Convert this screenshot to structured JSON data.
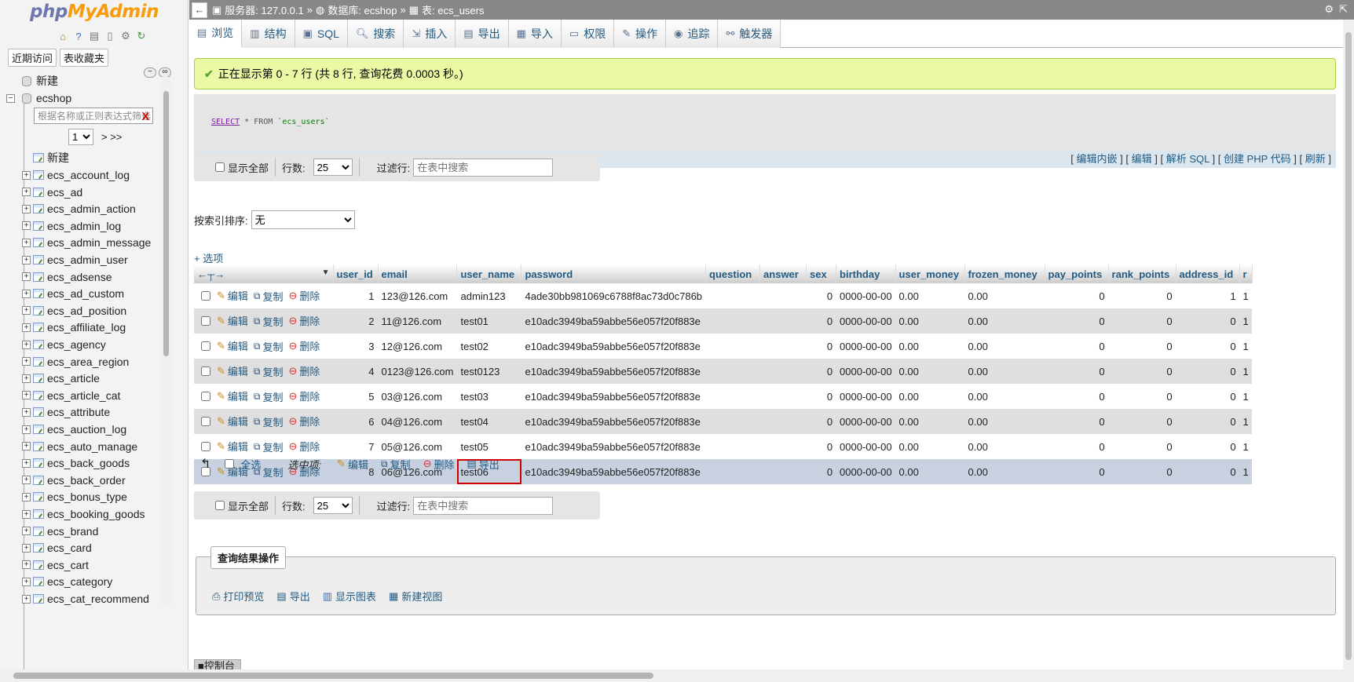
{
  "app": {
    "logo_part1": "php",
    "logo_part2": "MyAdmin",
    "recent_label": "近期访问",
    "favorites_label": "表收藏夹"
  },
  "nav": {
    "new_label": "新建",
    "db_name": "ecshop",
    "filter_placeholder": "根据名称或正则表达式筛选",
    "filter_clear": "X",
    "page_select": "1",
    "page_next": "> >>",
    "db_new_label": "新建",
    "tables": [
      "ecs_account_log",
      "ecs_ad",
      "ecs_admin_action",
      "ecs_admin_log",
      "ecs_admin_message",
      "ecs_admin_user",
      "ecs_adsense",
      "ecs_ad_custom",
      "ecs_ad_position",
      "ecs_affiliate_log",
      "ecs_agency",
      "ecs_area_region",
      "ecs_article",
      "ecs_article_cat",
      "ecs_attribute",
      "ecs_auction_log",
      "ecs_auto_manage",
      "ecs_back_goods",
      "ecs_back_order",
      "ecs_bonus_type",
      "ecs_booking_goods",
      "ecs_brand",
      "ecs_card",
      "ecs_cart",
      "ecs_category",
      "ecs_cat_recommend"
    ]
  },
  "breadcrumb": {
    "server": "服务器: 127.0.0.1",
    "database": "数据库: ecshop",
    "table": "表: ecs_users",
    "sep": "»"
  },
  "tabs": [
    {
      "label": "浏览",
      "icon": "browse-icon"
    },
    {
      "label": "结构",
      "icon": "structure-icon"
    },
    {
      "label": "SQL",
      "icon": "sql-icon"
    },
    {
      "label": "搜索",
      "icon": "search-icon"
    },
    {
      "label": "插入",
      "icon": "insert-icon"
    },
    {
      "label": "导出",
      "icon": "export-icon"
    },
    {
      "label": "导入",
      "icon": "import-icon"
    },
    {
      "label": "权限",
      "icon": "privileges-icon"
    },
    {
      "label": "操作",
      "icon": "operations-icon"
    },
    {
      "label": "追踪",
      "icon": "tracking-icon"
    },
    {
      "label": "触发器",
      "icon": "triggers-icon"
    }
  ],
  "result": {
    "message": "正在显示第 0 - 7 行 (共 8 行, 查询花费 0.0003 秒。)",
    "sql_select": "SELECT",
    "sql_rest": "* FROM",
    "sql_table": "`ecs_users`",
    "sql_links": [
      "编辑内嵌",
      "编辑",
      "解析 SQL",
      "创建 PHP 代码",
      "刷新"
    ]
  },
  "navbar": {
    "show_all": "显示全部",
    "rows_label": "行数:",
    "rows_value": "25",
    "filter_label": "过滤行:",
    "filter_placeholder": "在表中搜索"
  },
  "sort": {
    "label": "按索引排序:",
    "value": "无"
  },
  "options_link": "+ 选项",
  "actions": {
    "edit": "编辑",
    "copy": "复制",
    "delete": "删除"
  },
  "columns": [
    "user_id",
    "email",
    "user_name",
    "password",
    "question",
    "answer",
    "sex",
    "birthday",
    "user_money",
    "frozen_money",
    "pay_points",
    "rank_points",
    "address_id",
    "r"
  ],
  "rows": [
    {
      "user_id": "1",
      "email": "123@126.com",
      "user_name": "admin123",
      "password": "4ade30bb981069c6788f8ac73d0c786b",
      "question": "",
      "answer": "",
      "sex": "0",
      "birthday": "0000-00-00",
      "user_money": "0.00",
      "frozen_money": "0.00",
      "pay_points": "0",
      "rank_points": "0",
      "address_id": "1",
      "r": "1"
    },
    {
      "user_id": "2",
      "email": "11@126.com",
      "user_name": "test01",
      "password": "e10adc3949ba59abbe56e057f20f883e",
      "question": "",
      "answer": "",
      "sex": "0",
      "birthday": "0000-00-00",
      "user_money": "0.00",
      "frozen_money": "0.00",
      "pay_points": "0",
      "rank_points": "0",
      "address_id": "0",
      "r": "1"
    },
    {
      "user_id": "3",
      "email": "12@126.com",
      "user_name": "test02",
      "password": "e10adc3949ba59abbe56e057f20f883e",
      "question": "",
      "answer": "",
      "sex": "0",
      "birthday": "0000-00-00",
      "user_money": "0.00",
      "frozen_money": "0.00",
      "pay_points": "0",
      "rank_points": "0",
      "address_id": "0",
      "r": "1"
    },
    {
      "user_id": "4",
      "email": "0123@126.com",
      "user_name": "test0123",
      "password": "e10adc3949ba59abbe56e057f20f883e",
      "question": "",
      "answer": "",
      "sex": "0",
      "birthday": "0000-00-00",
      "user_money": "0.00",
      "frozen_money": "0.00",
      "pay_points": "0",
      "rank_points": "0",
      "address_id": "0",
      "r": "1"
    },
    {
      "user_id": "5",
      "email": "03@126.com",
      "user_name": "test03",
      "password": "e10adc3949ba59abbe56e057f20f883e",
      "question": "",
      "answer": "",
      "sex": "0",
      "birthday": "0000-00-00",
      "user_money": "0.00",
      "frozen_money": "0.00",
      "pay_points": "0",
      "rank_points": "0",
      "address_id": "0",
      "r": "1"
    },
    {
      "user_id": "6",
      "email": "04@126.com",
      "user_name": "test04",
      "password": "e10adc3949ba59abbe56e057f20f883e",
      "question": "",
      "answer": "",
      "sex": "0",
      "birthday": "0000-00-00",
      "user_money": "0.00",
      "frozen_money": "0.00",
      "pay_points": "0",
      "rank_points": "0",
      "address_id": "0",
      "r": "1"
    },
    {
      "user_id": "7",
      "email": "05@126.com",
      "user_name": "test05",
      "password": "e10adc3949ba59abbe56e057f20f883e",
      "question": "",
      "answer": "",
      "sex": "0",
      "birthday": "0000-00-00",
      "user_money": "0.00",
      "frozen_money": "0.00",
      "pay_points": "0",
      "rank_points": "0",
      "address_id": "0",
      "r": "1"
    },
    {
      "user_id": "8",
      "email": "06@126.com",
      "user_name": "test06",
      "password": "e10adc3949ba59abbe56e057f20f883e",
      "question": "",
      "answer": "",
      "sex": "0",
      "birthday": "0000-00-00",
      "user_money": "0.00",
      "frozen_money": "0.00",
      "pay_points": "0",
      "rank_points": "0",
      "address_id": "0",
      "r": "1"
    }
  ],
  "with_selected": {
    "check_all": "全选",
    "label": "选中项:",
    "edit": "编辑",
    "copy": "复制",
    "delete": "删除",
    "export": "导出"
  },
  "query_ops": {
    "title": "查询结果操作",
    "print": "打印预览",
    "export": "导出",
    "chart": "显示图表",
    "view": "新建视图"
  },
  "console_label": "控制台",
  "colors": {
    "link": "#235a81",
    "success_bg": "#ebf8a4",
    "highlight_row": "#c7d1e0",
    "highlight_box": "#d40000"
  }
}
